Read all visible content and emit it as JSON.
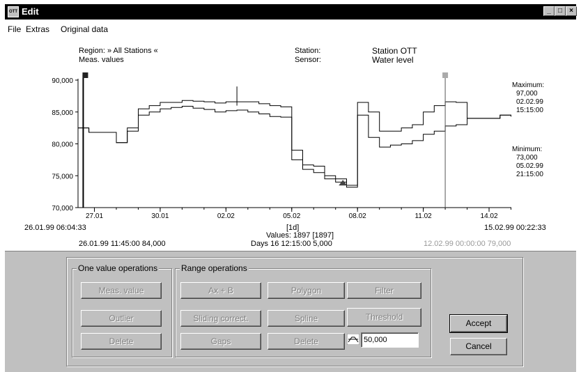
{
  "window": {
    "title": "Edit",
    "icon_text": "OTT",
    "minimize": "_",
    "maximize": "□",
    "close": "×"
  },
  "menu": {
    "file": "File",
    "extras": "Extras",
    "original": "Original data"
  },
  "header": {
    "region": "Region: » All Stations «",
    "meas": "Meas. values",
    "station_label": "Station:",
    "sensor_label": "Sensor:",
    "station": "Station OTT",
    "sensor": "Water level"
  },
  "stats": {
    "max_label": "Maximum:",
    "max_value": "97,000",
    "max_date": "02.02.99",
    "max_time": "15:15:00",
    "min_label": "Minimum:",
    "min_value": "73,000",
    "min_date": "05.02.99",
    "min_time": "21:15:00"
  },
  "footer": {
    "start": "26.01.99 06:04:33",
    "end": "15.02.99 00:22:33",
    "interval": "[1d]",
    "values": "Values: 1897 [1897]",
    "cursor_left": "26.01.99 11:45:00   84,000",
    "days": "Days 16   12:15:00   5,000",
    "cursor_right": "12.02.99 00:00:00   79,000"
  },
  "chart_data": {
    "type": "line",
    "ylim": [
      70000,
      90000
    ],
    "yticks": [
      "90,000",
      "85,000",
      "80,000",
      "75,000",
      "70,000"
    ],
    "xticks": [
      "27.01",
      "30.01",
      "02.02",
      "05.02",
      "08.02",
      "11.02",
      "14.02"
    ],
    "series": [
      {
        "x": [
          "26.01 06:00",
          "26.01 18:00",
          "27.01 12:00",
          "28.01 00:00",
          "28.01 12:00",
          "29.01 00:00",
          "29.01 12:00",
          "30.01 00:00",
          "30.01 12:00",
          "31.01 00:00",
          "31.01 12:00",
          "01.02 00:00",
          "01.02 12:00",
          "02.02 00:00",
          "02.02 12:00",
          "03.02 00:00",
          "03.02 12:00",
          "04.02 00:00",
          "04.02 12:00",
          "05.02 00:00",
          "05.02 12:00",
          "06.02 00:00",
          "06.02 12:00",
          "07.02 00:00",
          "07.02 12:00",
          "08.02 00:00",
          "08.02 12:00",
          "09.02 00:00",
          "09.02 12:00",
          "10.02 00:00",
          "10.02 12:00",
          "11.02 00:00",
          "11.02 12:00",
          "12.02 00:00",
          "12.02 12:00",
          "13.02 00:00",
          "13.02 12:00",
          "14.02 00:00",
          "14.02 12:00",
          "15.02 00:00"
        ],
        "values": [
          82500,
          81800,
          81800,
          80200,
          82500,
          85500,
          86000,
          86500,
          86500,
          86800,
          86700,
          86600,
          86400,
          86600,
          86600,
          86600,
          86300,
          86000,
          85800,
          79000,
          76700,
          76500,
          75000,
          74500,
          73500,
          86500,
          85000,
          82000,
          82000,
          82500,
          83000,
          85000,
          86000,
          86600,
          86500,
          84000,
          84000,
          84000,
          84500,
          84300
        ]
      },
      {
        "x": [
          "26.01 06:00",
          "26.01 18:00",
          "27.01 12:00",
          "28.01 00:00",
          "28.01 12:00",
          "29.01 00:00",
          "29.01 12:00",
          "30.01 00:00",
          "30.01 12:00",
          "31.01 00:00",
          "31.01 12:00",
          "01.02 00:00",
          "01.02 12:00",
          "02.02 00:00",
          "02.02 12:00",
          "03.02 00:00",
          "03.02 12:00",
          "04.02 00:00",
          "04.02 12:00",
          "05.02 00:00",
          "05.02 12:00",
          "06.02 00:00",
          "06.02 12:00",
          "07.02 00:00",
          "07.02 12:00",
          "08.02 00:00",
          "08.02 12:00",
          "09.02 00:00",
          "09.02 12:00",
          "10.02 00:00",
          "10.02 12:00",
          "11.02 00:00",
          "11.02 12:00",
          "12.02 00:00",
          "12.02 12:00",
          "13.02 00:00",
          "13.02 12:00",
          "14.02 00:00",
          "14.02 12:00",
          "15.02 00:00"
        ],
        "values": [
          82500,
          81800,
          81800,
          80200,
          82000,
          84500,
          85000,
          85500,
          85700,
          85900,
          85600,
          85400,
          85000,
          85200,
          85300,
          85000,
          84700,
          84300,
          84200,
          77500,
          76000,
          75500,
          74500,
          74000,
          73200,
          84500,
          81000,
          79500,
          79800,
          80000,
          80500,
          81500,
          82000,
          82800,
          83000,
          84000,
          84000,
          84000,
          84500,
          84300
        ]
      }
    ]
  },
  "ops": {
    "one_title": "One value operations",
    "range_title": "Range operations",
    "meas_value": "Meas. value",
    "outlier": "Outlier",
    "delete1": "Delete",
    "axb": "Ax + B",
    "sliding": "Sliding correct.",
    "gaps": "Gaps",
    "polygon": "Polygon",
    "spline": "Spline",
    "delete2": "Delete",
    "filter": "Filter",
    "threshold": "Threshold",
    "threshold_value": "50,000",
    "accept": "Accept",
    "cancel": "Cancel"
  }
}
